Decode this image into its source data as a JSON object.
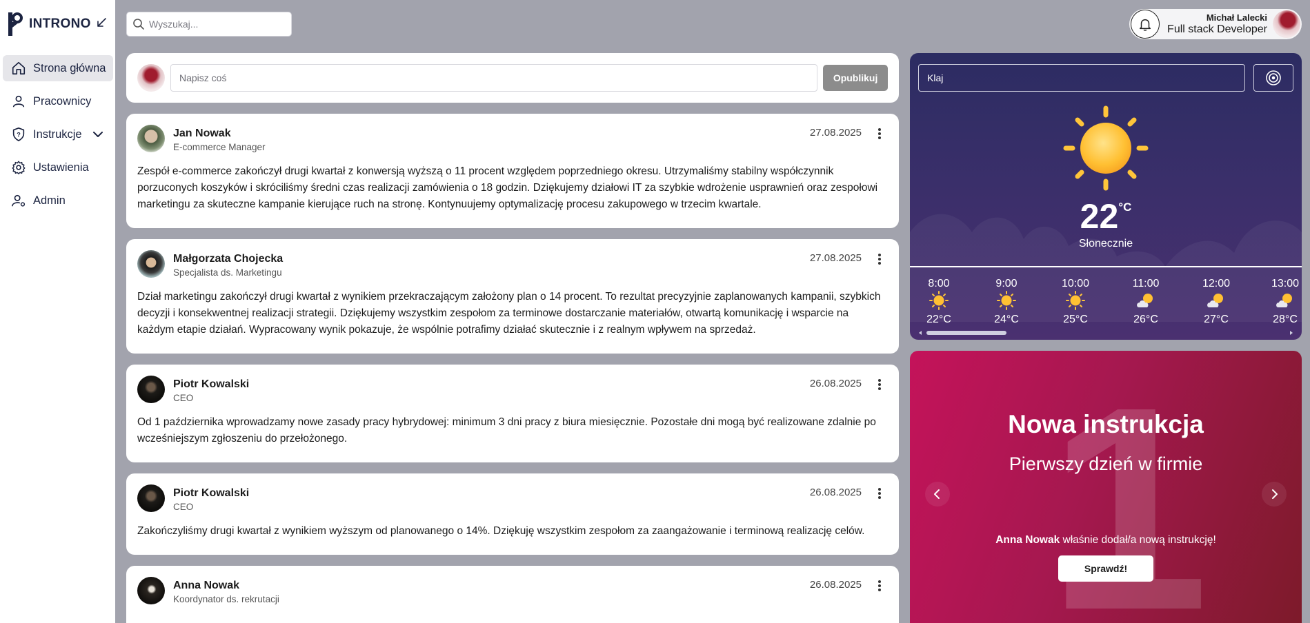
{
  "app": {
    "logo_text": "INTRONO"
  },
  "sidebar": {
    "items": [
      {
        "label": "Strona główna",
        "icon": "home-icon",
        "active": true
      },
      {
        "label": "Pracownicy",
        "icon": "user-icon"
      },
      {
        "label": "Instrukcje",
        "icon": "shield-icon",
        "has_dropdown": true
      },
      {
        "label": "Ustawienia",
        "icon": "gear-icon"
      },
      {
        "label": "Admin",
        "icon": "user-gear-icon"
      }
    ]
  },
  "search": {
    "placeholder": "Wyszukaj..."
  },
  "user": {
    "name": "Michał Lalecki",
    "role": "Full stack Developer"
  },
  "composer": {
    "placeholder": "Napisz coś",
    "publish_label": "Opublikuj"
  },
  "posts": [
    {
      "author": "Jan Nowak",
      "position": "E-commerce Manager",
      "date": "27.08.2025",
      "body": "Zespół e-commerce zakończył drugi kwartał z konwersją wyższą o 11 procent względem poprzedniego okresu. Utrzymaliśmy stabilny współczynnik porzuconych koszyków i skróciliśmy średni czas realizacji zamówienia o 18 godzin. Dziękujemy działowi IT za szybkie wdrożenie usprawnień oraz zespołowi marketingu za skuteczne kampanie kierujące ruch na stronę. Kontynuujemy optymalizację procesu zakupowego w trzecim kwartale."
    },
    {
      "author": "Małgorzata Chojecka",
      "position": "Specjalista ds. Marketingu",
      "date": "27.08.2025",
      "body": "Dział marketingu zakończył drugi kwartał z wynikiem przekraczającym założony plan o 14 procent. To rezultat precyzyjnie zaplanowanych kampanii, szybkich decyzji i konsekwentnej realizacji strategii. Dziękujemy wszystkim zespołom za terminowe dostarczanie materiałów, otwartą komunikację i wsparcie na każdym etapie działań. Wypracowany wynik pokazuje, że wspólnie potrafimy działać skutecznie i z realnym wpływem na sprzedaż."
    },
    {
      "author": "Piotr Kowalski",
      "position": "CEO",
      "date": "26.08.2025",
      "body": "Od 1 października wprowadzamy nowe zasady pracy hybrydowej: minimum 3 dni pracy z biura miesięcznie. Pozostałe dni mogą być realizowane zdalnie po wcześniejszym zgłoszeniu do przełożonego."
    },
    {
      "author": "Piotr Kowalski",
      "position": "CEO",
      "date": "26.08.2025",
      "body": "Zakończyliśmy drugi kwartał z wynikiem wyższym od planowanego o 14%. Dziękuję wszystkim zespołom za zaangażowanie i terminową realizację celów."
    },
    {
      "author": "Anna Nowak",
      "position": "Koordynator ds. rekrutacji",
      "date": "26.08.2025",
      "body": ""
    }
  ],
  "weather": {
    "city_value": "Klaj",
    "temperature": "22",
    "unit": "°C",
    "condition": "Słonecznie",
    "hourly": [
      {
        "time": "8:00",
        "temp": "22°C",
        "icon": "sun-icon"
      },
      {
        "time": "9:00",
        "temp": "24°C",
        "icon": "sun-icon"
      },
      {
        "time": "10:00",
        "temp": "25°C",
        "icon": "sun-icon"
      },
      {
        "time": "11:00",
        "temp": "26°C",
        "icon": "partly-cloudy-icon"
      },
      {
        "time": "12:00",
        "temp": "27°C",
        "icon": "partly-cloudy-icon"
      },
      {
        "time": "13:00",
        "temp": "28°C",
        "icon": "partly-cloudy-icon"
      }
    ]
  },
  "instruction": {
    "big_number": "1",
    "title": "Nowa instrukcja",
    "subtitle": "Pierwszy dzień w firmie",
    "author": "Anna Nowak",
    "note": " właśnie dodał/a nową instrukcję!",
    "button_label": "Sprawdź!"
  },
  "colors": {
    "accent": "#1b2340",
    "weather_bg": "#2c2c62",
    "instruction_bg": "#c4135a",
    "publish_bg": "#8c8c8c"
  }
}
